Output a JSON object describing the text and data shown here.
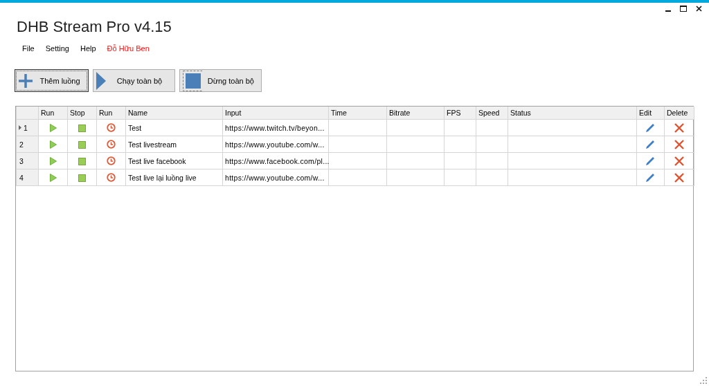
{
  "window": {
    "title": "DHB Stream Pro v4.15"
  },
  "menu": [
    {
      "label": "File",
      "kind": "item"
    },
    {
      "label": "Setting",
      "kind": "item"
    },
    {
      "label": "Help",
      "kind": "item"
    },
    {
      "label": "Đỗ Hữu Ben",
      "kind": "author"
    }
  ],
  "toolbar": [
    {
      "label": "Thêm luồng",
      "kind": "add",
      "focused": true
    },
    {
      "label": "Chạy toàn bộ",
      "kind": "play",
      "focused": false
    },
    {
      "label": "Dừng toàn bộ",
      "kind": "stop",
      "focused": false
    }
  ],
  "table": {
    "columns": [
      "Run",
      "Stop",
      "Run",
      "Name",
      "Input",
      "Time",
      "Bitrate",
      "FPS",
      "Speed",
      "Status",
      "Edit",
      "Delete"
    ],
    "rows": [
      {
        "number": "1",
        "current": true,
        "name": "Test",
        "input": "https://www.twitch.tv/beyon..."
      },
      {
        "number": "2",
        "current": false,
        "name": "Test livestream",
        "input": "https://www.youtube.com/w..."
      },
      {
        "number": "3",
        "current": false,
        "name": "Test live facebook",
        "input": "https://www.facebook.com/pl..."
      },
      {
        "number": "4",
        "current": false,
        "name": "Test live lại luồng live",
        "input": "https://www.youtube.com/w..."
      }
    ]
  }
}
